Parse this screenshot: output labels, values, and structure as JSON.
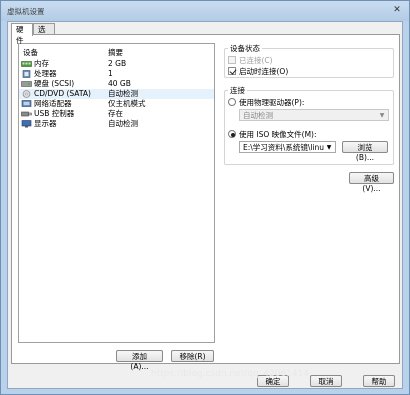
{
  "window": {
    "title": "虚拟机设置",
    "close_glyph": "✕"
  },
  "tabs": [
    {
      "label": "硬件",
      "active": true
    },
    {
      "label": "选项",
      "active": false
    }
  ],
  "device_list": {
    "headers": {
      "device": "设备",
      "summary": "摘要"
    },
    "rows": [
      {
        "name": "内存",
        "summary": "2 GB",
        "icon": "memory-icon"
      },
      {
        "name": "处理器",
        "summary": "1",
        "icon": "processor-icon"
      },
      {
        "name": "硬盘 (SCSI)",
        "summary": "40 GB",
        "icon": "hard-disk-icon"
      },
      {
        "name": "CD/DVD (SATA)",
        "summary": "自动检测",
        "icon": "cd-dvd-icon",
        "selected": true
      },
      {
        "name": "网络适配器",
        "summary": "仅主机模式",
        "icon": "network-adapter-icon"
      },
      {
        "name": "USB 控制器",
        "summary": "存在",
        "icon": "usb-controller-icon"
      },
      {
        "name": "显示器",
        "summary": "自动检测",
        "icon": "display-icon"
      }
    ]
  },
  "device_buttons": {
    "add": "添加(A)...",
    "remove": "移除(R)"
  },
  "device_status": {
    "title": "设备状态",
    "connected": {
      "label": "已连接(C)",
      "checked": false,
      "enabled": false
    },
    "connect_on_power": {
      "label": "启动时连接(O)",
      "checked": true
    }
  },
  "connection": {
    "title": "连接",
    "physical": {
      "label": "使用物理驱动器(P):",
      "selected": false,
      "drive_value": "自动检测"
    },
    "iso": {
      "label": "使用 ISO 映像文件(M):",
      "selected": true,
      "path_value": "E:\\学习资料\\系统镜\\linux系统",
      "browse": "浏览(B)..."
    }
  },
  "advanced_button": "高级(V)...",
  "footer": {
    "ok": "确定",
    "cancel": "取消",
    "help": "帮助"
  },
  "watermark": "https://blog.csdn.net/qq_42061414"
}
